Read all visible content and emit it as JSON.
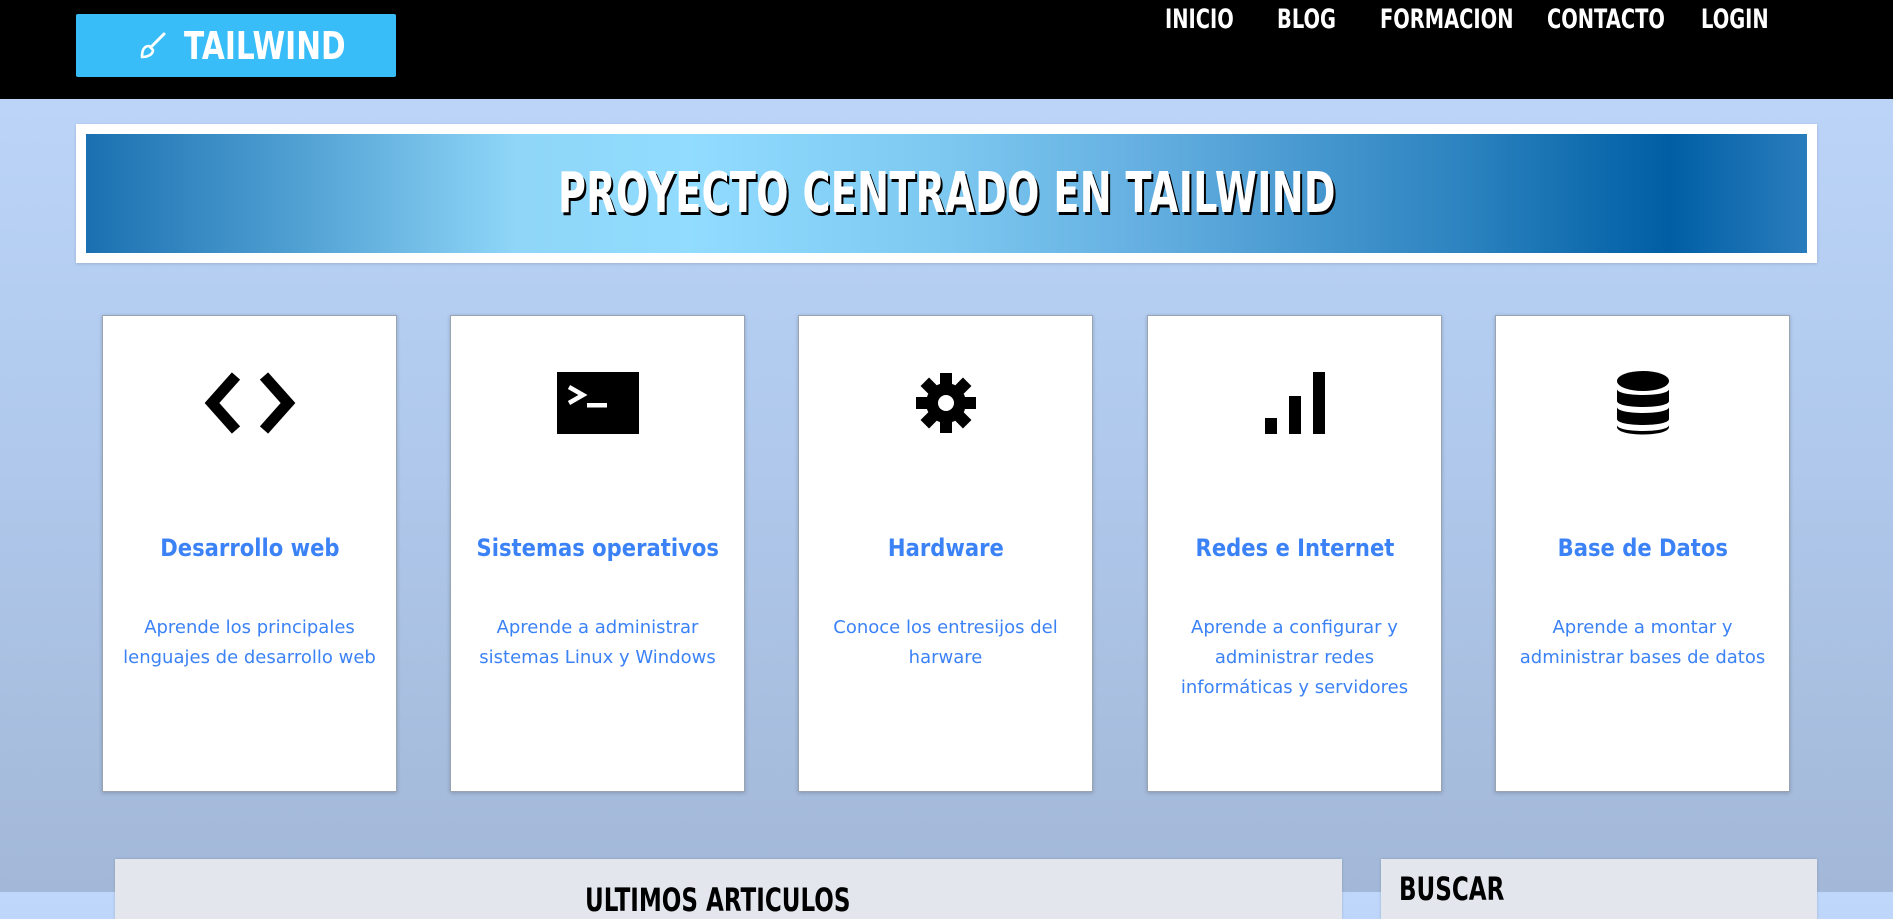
{
  "header": {
    "logo_text": "TAILWIND",
    "logo_color": "#38bdf8",
    "nav": [
      {
        "label": "INICIO"
      },
      {
        "label": "BLOG"
      },
      {
        "label": "FORMACION"
      },
      {
        "label": "CONTACTO"
      },
      {
        "label": "LOGIN"
      }
    ]
  },
  "hero": {
    "title": "PROYECTO CENTRADO EN TAILWIND"
  },
  "cards": [
    {
      "icon": "code-icon",
      "title": "Desarrollo web",
      "desc": "Aprende los principales lenguajes de desarrollo web"
    },
    {
      "icon": "terminal-icon",
      "title": "Sistemas operativos",
      "desc": "Aprende a administrar sistemas Linux y Windows"
    },
    {
      "icon": "gear-icon",
      "title": "Hardware",
      "desc": "Conoce los entresijos del harware"
    },
    {
      "icon": "signal-bars-icon",
      "title": "Redes e Internet",
      "desc": "Aprende a configurar y administrar redes informáticas y servidores"
    },
    {
      "icon": "database-icon",
      "title": "Base de Datos",
      "desc": "Aprende a montar y administrar bases de datos"
    }
  ],
  "sections": {
    "articles_title": "ULTIMOS ARTICULOS",
    "search_title": "BUSCAR"
  },
  "colors": {
    "accent": "#3b82f6",
    "topbar": "#000000"
  }
}
